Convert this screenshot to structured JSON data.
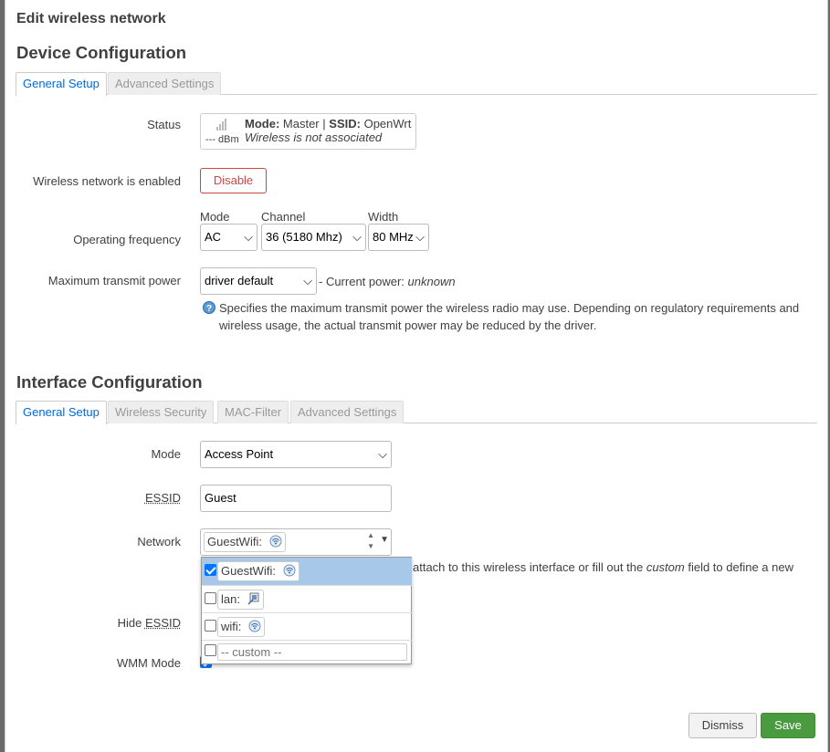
{
  "modal": {
    "title": "Edit wireless network"
  },
  "device": {
    "heading": "Device Configuration",
    "tabs": [
      "General Setup",
      "Advanced Settings"
    ],
    "status": {
      "label": "Status",
      "mode_key": "Mode:",
      "mode_val": "Master",
      "sep": "|",
      "ssid_key": "SSID:",
      "ssid_val": "OpenWrt",
      "signal": "--- dBm",
      "assoc": "Wireless is not associated"
    },
    "enabled": {
      "label": "Wireless network is enabled",
      "button": "Disable"
    },
    "frequency": {
      "label": "Operating frequency",
      "mode_label": "Mode",
      "mode_value": "AC",
      "channel_label": "Channel",
      "channel_value": "36 (5180 Mhz)",
      "width_label": "Width",
      "width_value": "80 MHz"
    },
    "txpower": {
      "label": "Maximum transmit power",
      "value": "driver default",
      "current_prefix": "- Current power:",
      "current_value": "unknown",
      "help_line1": "Specifies the maximum transmit power the wireless radio may use. Depending on regulatory requirements and",
      "help_line2": "wireless usage, the actual transmit power may be reduced by the driver."
    }
  },
  "iface": {
    "heading": "Interface Configuration",
    "tabs": [
      "General Setup",
      "Wireless Security",
      "MAC-Filter",
      "Advanced Settings"
    ],
    "mode": {
      "label": "Mode",
      "value": "Access Point"
    },
    "essid": {
      "label": "ESSID",
      "value": "Guest"
    },
    "network": {
      "label": "Network",
      "selected": "GuestWifi:",
      "help_pre": "attach to this wireless interface or fill out the",
      "help_em": "custom",
      "help_post": "field to define a new",
      "options": [
        {
          "label": "GuestWifi:",
          "checked": true,
          "icon": "wifi-icon"
        },
        {
          "label": "lan:",
          "checked": false,
          "icon": "ethernet-icon"
        },
        {
          "label": "wifi:",
          "checked": false,
          "icon": "wifi-icon"
        }
      ],
      "custom_placeholder": "-- custom --"
    },
    "hide_essid": {
      "label_pre": "Hide ",
      "label_abbr": "ESSID"
    },
    "wmm": {
      "label": "WMM Mode"
    }
  },
  "footer": {
    "dismiss": "Dismiss",
    "save": "Save"
  },
  "colors": {
    "accent": "#0069d6",
    "save_bg": "#4a9b3f",
    "danger": "#c44",
    "selected_row": "#a8c8ea"
  }
}
